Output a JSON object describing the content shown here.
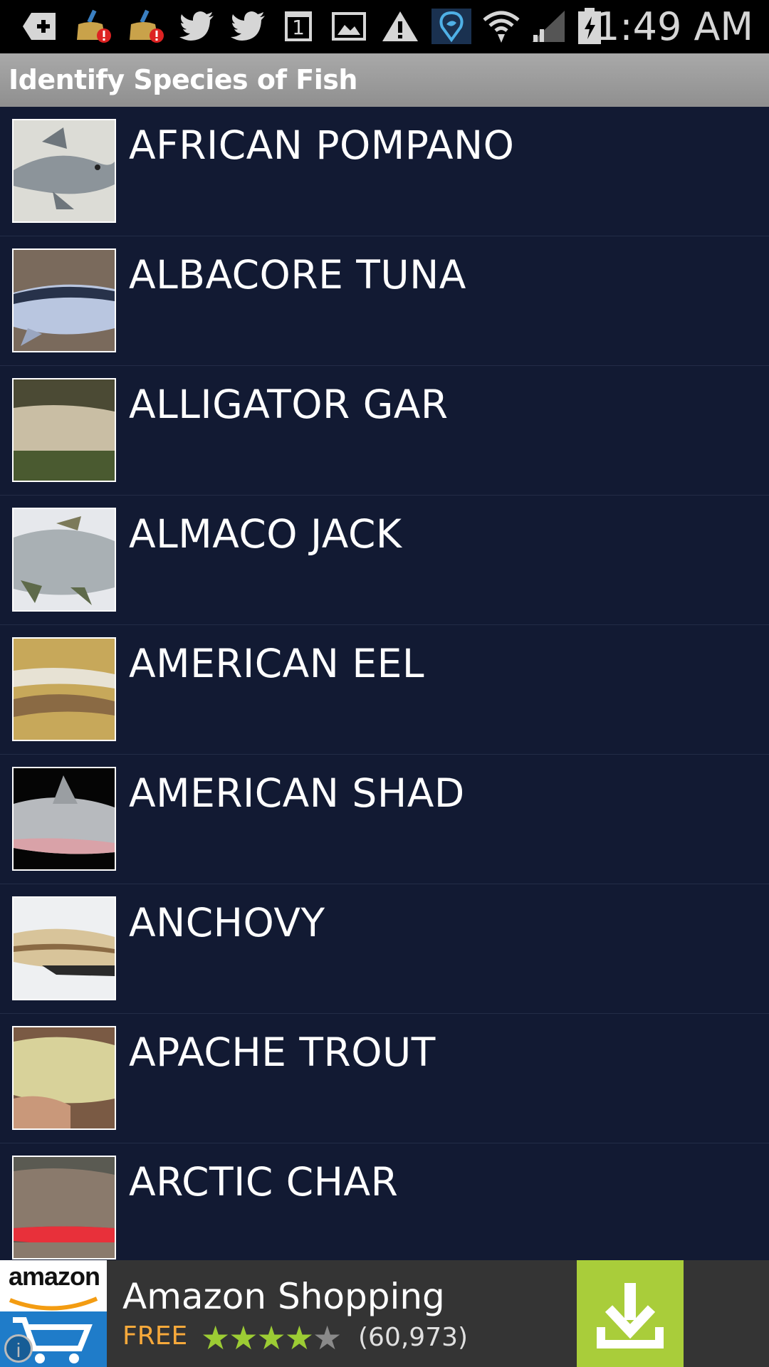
{
  "status_bar": {
    "time": "1:49 AM",
    "icons": [
      "add-notification-icon",
      "cleaner-alert-icon",
      "cleaner-alert-icon",
      "twitter-icon",
      "twitter-icon",
      "calendar-icon",
      "gallery-icon",
      "warning-icon",
      "fishing-app-icon",
      "wifi-icon",
      "signal-icon",
      "battery-charging-icon"
    ],
    "calendar_day": "1"
  },
  "title_bar": {
    "title": "Identify Species of Fish"
  },
  "species_list": [
    {
      "name": "AFRICAN POMPANO"
    },
    {
      "name": "ALBACORE TUNA"
    },
    {
      "name": "ALLIGATOR GAR"
    },
    {
      "name": "ALMACO JACK"
    },
    {
      "name": "AMERICAN EEL"
    },
    {
      "name": "AMERICAN SHAD"
    },
    {
      "name": "ANCHOVY"
    },
    {
      "name": "APACHE TROUT"
    },
    {
      "name": "ARCTIC CHAR"
    }
  ],
  "ad_banner": {
    "logo_text": "amazon",
    "title": "Amazon Shopping",
    "price": "FREE",
    "rating": 4.5,
    "rating_max": 5,
    "review_count": "(60,973)",
    "accent_color": "#a9cd3a",
    "price_color": "#f7a93b"
  }
}
